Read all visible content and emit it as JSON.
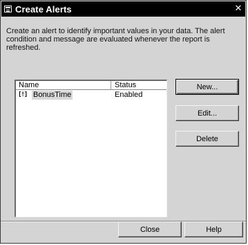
{
  "window": {
    "title": "Create Alerts",
    "close_glyph": "✕"
  },
  "description": "Create an alert to identify important values in your data. The alert condition and message are evaluated whenever the report is refreshed.",
  "alerts_list": {
    "columns": [
      "Name",
      "Status"
    ],
    "rows": [
      {
        "icon": "[!]",
        "name": "BonusTime",
        "status": "Enabled"
      }
    ]
  },
  "buttons": {
    "new": "New...",
    "edit": "Edit...",
    "delete": "Delete",
    "close": "Close",
    "help": "Help"
  }
}
